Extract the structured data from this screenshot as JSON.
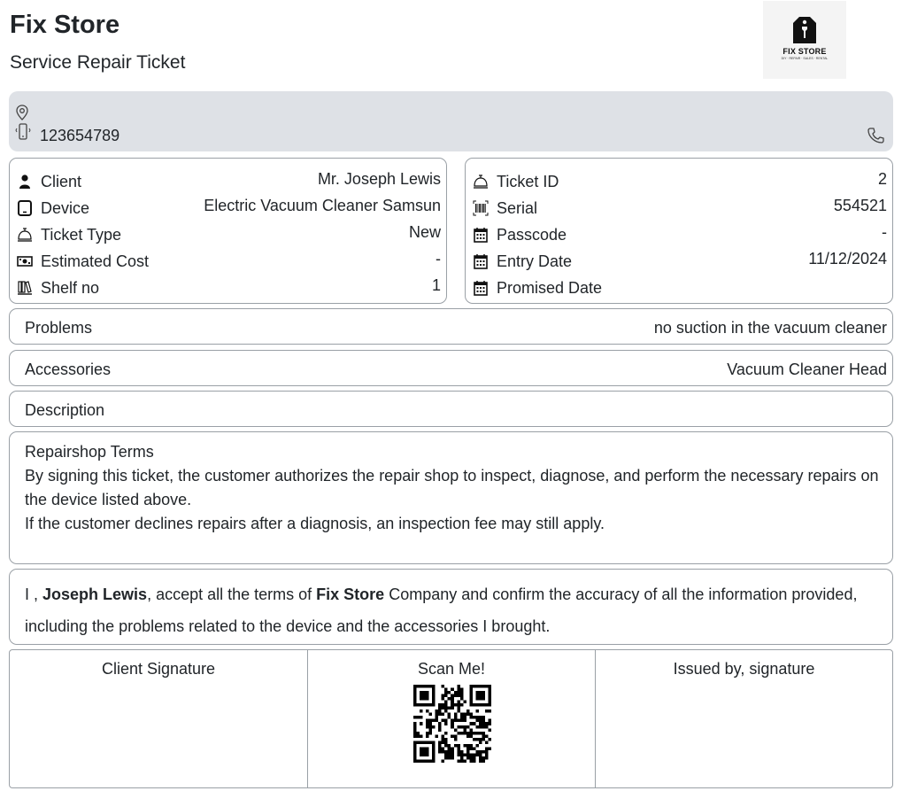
{
  "header": {
    "store_name": "Fix Store",
    "ticket_title": "Service Repair Ticket",
    "logo_text": "FIX STORE",
    "logo_tagline": "DIY · REPAIR · SALES · RENTAL"
  },
  "contact": {
    "address": "",
    "phone": "123654789",
    "icons": [
      "location-icon",
      "mobile-phone-icon",
      "call-icon"
    ]
  },
  "details_left": [
    {
      "label": "Client",
      "value": "Mr. Joseph Lewis",
      "icon": "person-icon"
    },
    {
      "label": "Device",
      "value": "Electric Vacuum Cleaner Samsun",
      "icon": "tablet-icon"
    },
    {
      "label": "Ticket Type",
      "value": "New",
      "icon": "service-bell-icon"
    },
    {
      "label": "Estimated Cost",
      "value": "-",
      "icon": "cash-icon"
    },
    {
      "label": "Shelf no",
      "value": "1",
      "icon": "shelf-icon"
    }
  ],
  "details_right": [
    {
      "label": "Ticket ID",
      "value": "2",
      "icon": "service-bell-icon"
    },
    {
      "label": "Serial",
      "value": "554521",
      "icon": "barcode-icon"
    },
    {
      "label": "Passcode",
      "value": "-",
      "icon": "calendar-icon"
    },
    {
      "label": "Entry Date",
      "value": "11/12/2024",
      "icon": "calendar-icon"
    },
    {
      "label": "Promised Date",
      "value": "",
      "icon": "calendar-icon"
    }
  ],
  "problems": {
    "label": "Problems",
    "value": "no suction in the vacuum cleaner"
  },
  "accessories": {
    "label": "Accessories",
    "value": "Vacuum Cleaner Head"
  },
  "description": {
    "label": "Description",
    "value": ""
  },
  "terms": {
    "title": "Repairshop Terms",
    "line1": "By signing this ticket, the customer authorizes the repair shop to inspect, diagnose, and perform the necessary repairs on the device listed above.",
    "line2": "If the customer declines repairs after a diagnosis, an inspection fee may still apply."
  },
  "agreement": {
    "prefix": "I , ",
    "client_name": "Joseph Lewis",
    "middle": ", accept all the terms of ",
    "company": "Fix Store",
    "suffix": " Company and confirm the accuracy of all the information provided, including the problems related to the device and the accessories I brought."
  },
  "signatures": {
    "client_label": "Client Signature",
    "scan_label": "Scan Me!",
    "issuer_label": "Issued by, signature"
  },
  "colors": {
    "info_bar_bg": "#dee1e6",
    "border": "#9aa0a6",
    "text": "#212529"
  }
}
